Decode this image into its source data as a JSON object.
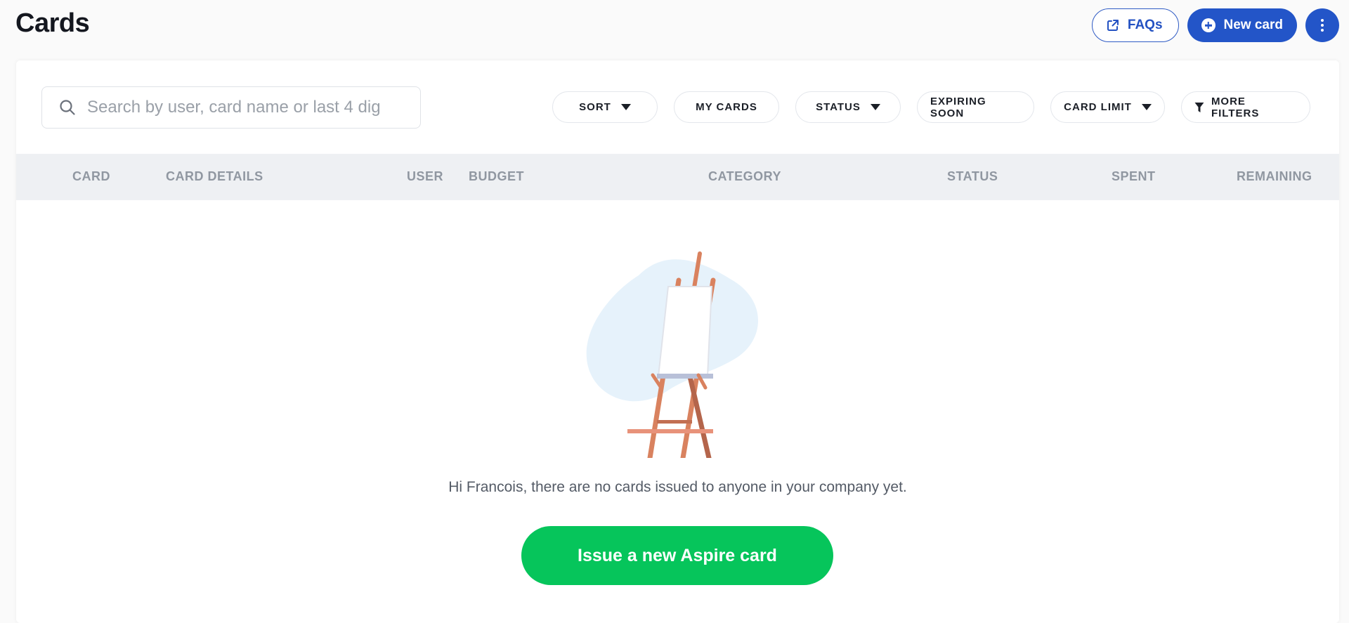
{
  "header": {
    "title": "Cards",
    "faqs_label": "FAQs",
    "new_card_label": "New card"
  },
  "search": {
    "placeholder": "Search by user, card name or last 4 dig"
  },
  "filters": {
    "sort": "SORT",
    "my_cards": "MY CARDS",
    "status": "STATUS",
    "expiring_soon": "EXPIRING SOON",
    "card_limit": "CARD LIMIT",
    "more_filters": "MORE FILTERS"
  },
  "table": {
    "columns": [
      "CARD",
      "CARD DETAILS",
      "USER",
      "BUDGET",
      "CATEGORY",
      "STATUS",
      "SPENT",
      "REMAINING"
    ]
  },
  "empty_state": {
    "message": "Hi Francois, there are no cards issued to anyone in your company yet.",
    "cta_label": "Issue a new Aspire card"
  },
  "colors": {
    "primary": "#2355c8",
    "cta": "#06c55b",
    "header_bg": "#eef0f3"
  }
}
